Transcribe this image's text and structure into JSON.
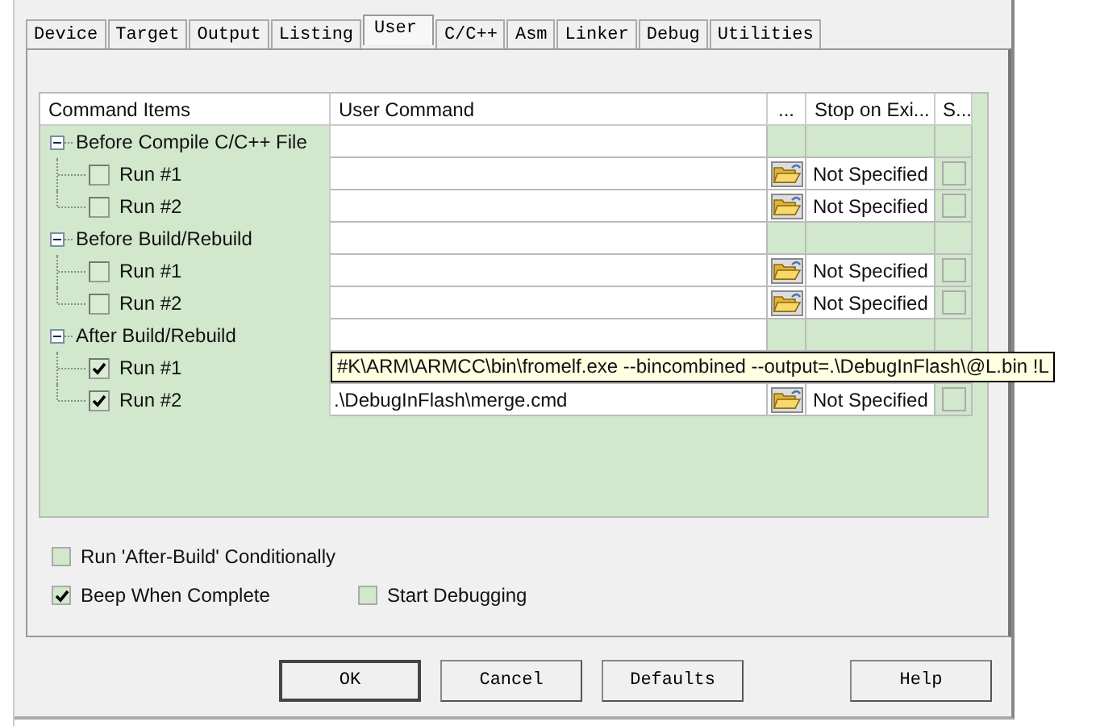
{
  "tabs": [
    {
      "label": "Device",
      "selected": false
    },
    {
      "label": "Target",
      "selected": false
    },
    {
      "label": "Output",
      "selected": false
    },
    {
      "label": "Listing",
      "selected": false
    },
    {
      "label": "User",
      "selected": true
    },
    {
      "label": "C/C++",
      "selected": false
    },
    {
      "label": "Asm",
      "selected": false
    },
    {
      "label": "Linker",
      "selected": false
    },
    {
      "label": "Debug",
      "selected": false
    },
    {
      "label": "Utilities",
      "selected": false
    }
  ],
  "grid": {
    "columns": [
      "Command Items",
      "User Command",
      "...",
      "Stop on Exi...",
      "S..."
    ],
    "groups": [
      {
        "label": "Before Compile C/C++ File",
        "expanded": true,
        "children": [
          {
            "label": "Run #1",
            "checked": false,
            "stop": "Not Specified",
            "s_checked": false
          },
          {
            "label": "Run #2",
            "checked": false,
            "stop": "Not Specified",
            "s_checked": false
          }
        ]
      },
      {
        "label": "Before Build/Rebuild",
        "expanded": true,
        "children": [
          {
            "label": "Run #1",
            "checked": false,
            "stop": "Not Specified",
            "s_checked": false
          },
          {
            "label": "Run #2",
            "checked": false,
            "stop": "Not Specified",
            "s_checked": false
          }
        ]
      },
      {
        "label": "After Build/Rebuild",
        "expanded": true,
        "children": [
          {
            "label": "Run #1",
            "checked": true,
            "tooltip": "#K\\ARM\\ARMCC\\bin\\fromelf.exe --bincombined --output=.\\DebugInFlash\\@L.bin !L"
          },
          {
            "label": "Run #2",
            "checked": true,
            "command": ".\\DebugInFlash\\merge.cmd",
            "stop": "Not Specified",
            "s_checked": false
          }
        ]
      }
    ]
  },
  "options": [
    {
      "label": "Run 'After-Build' Conditionally",
      "checked": false
    },
    {
      "label": "Beep When Complete",
      "checked": true
    },
    {
      "label": "Start Debugging",
      "checked": false
    }
  ],
  "buttons": [
    "OK",
    "Cancel",
    "Defaults",
    "Help"
  ]
}
